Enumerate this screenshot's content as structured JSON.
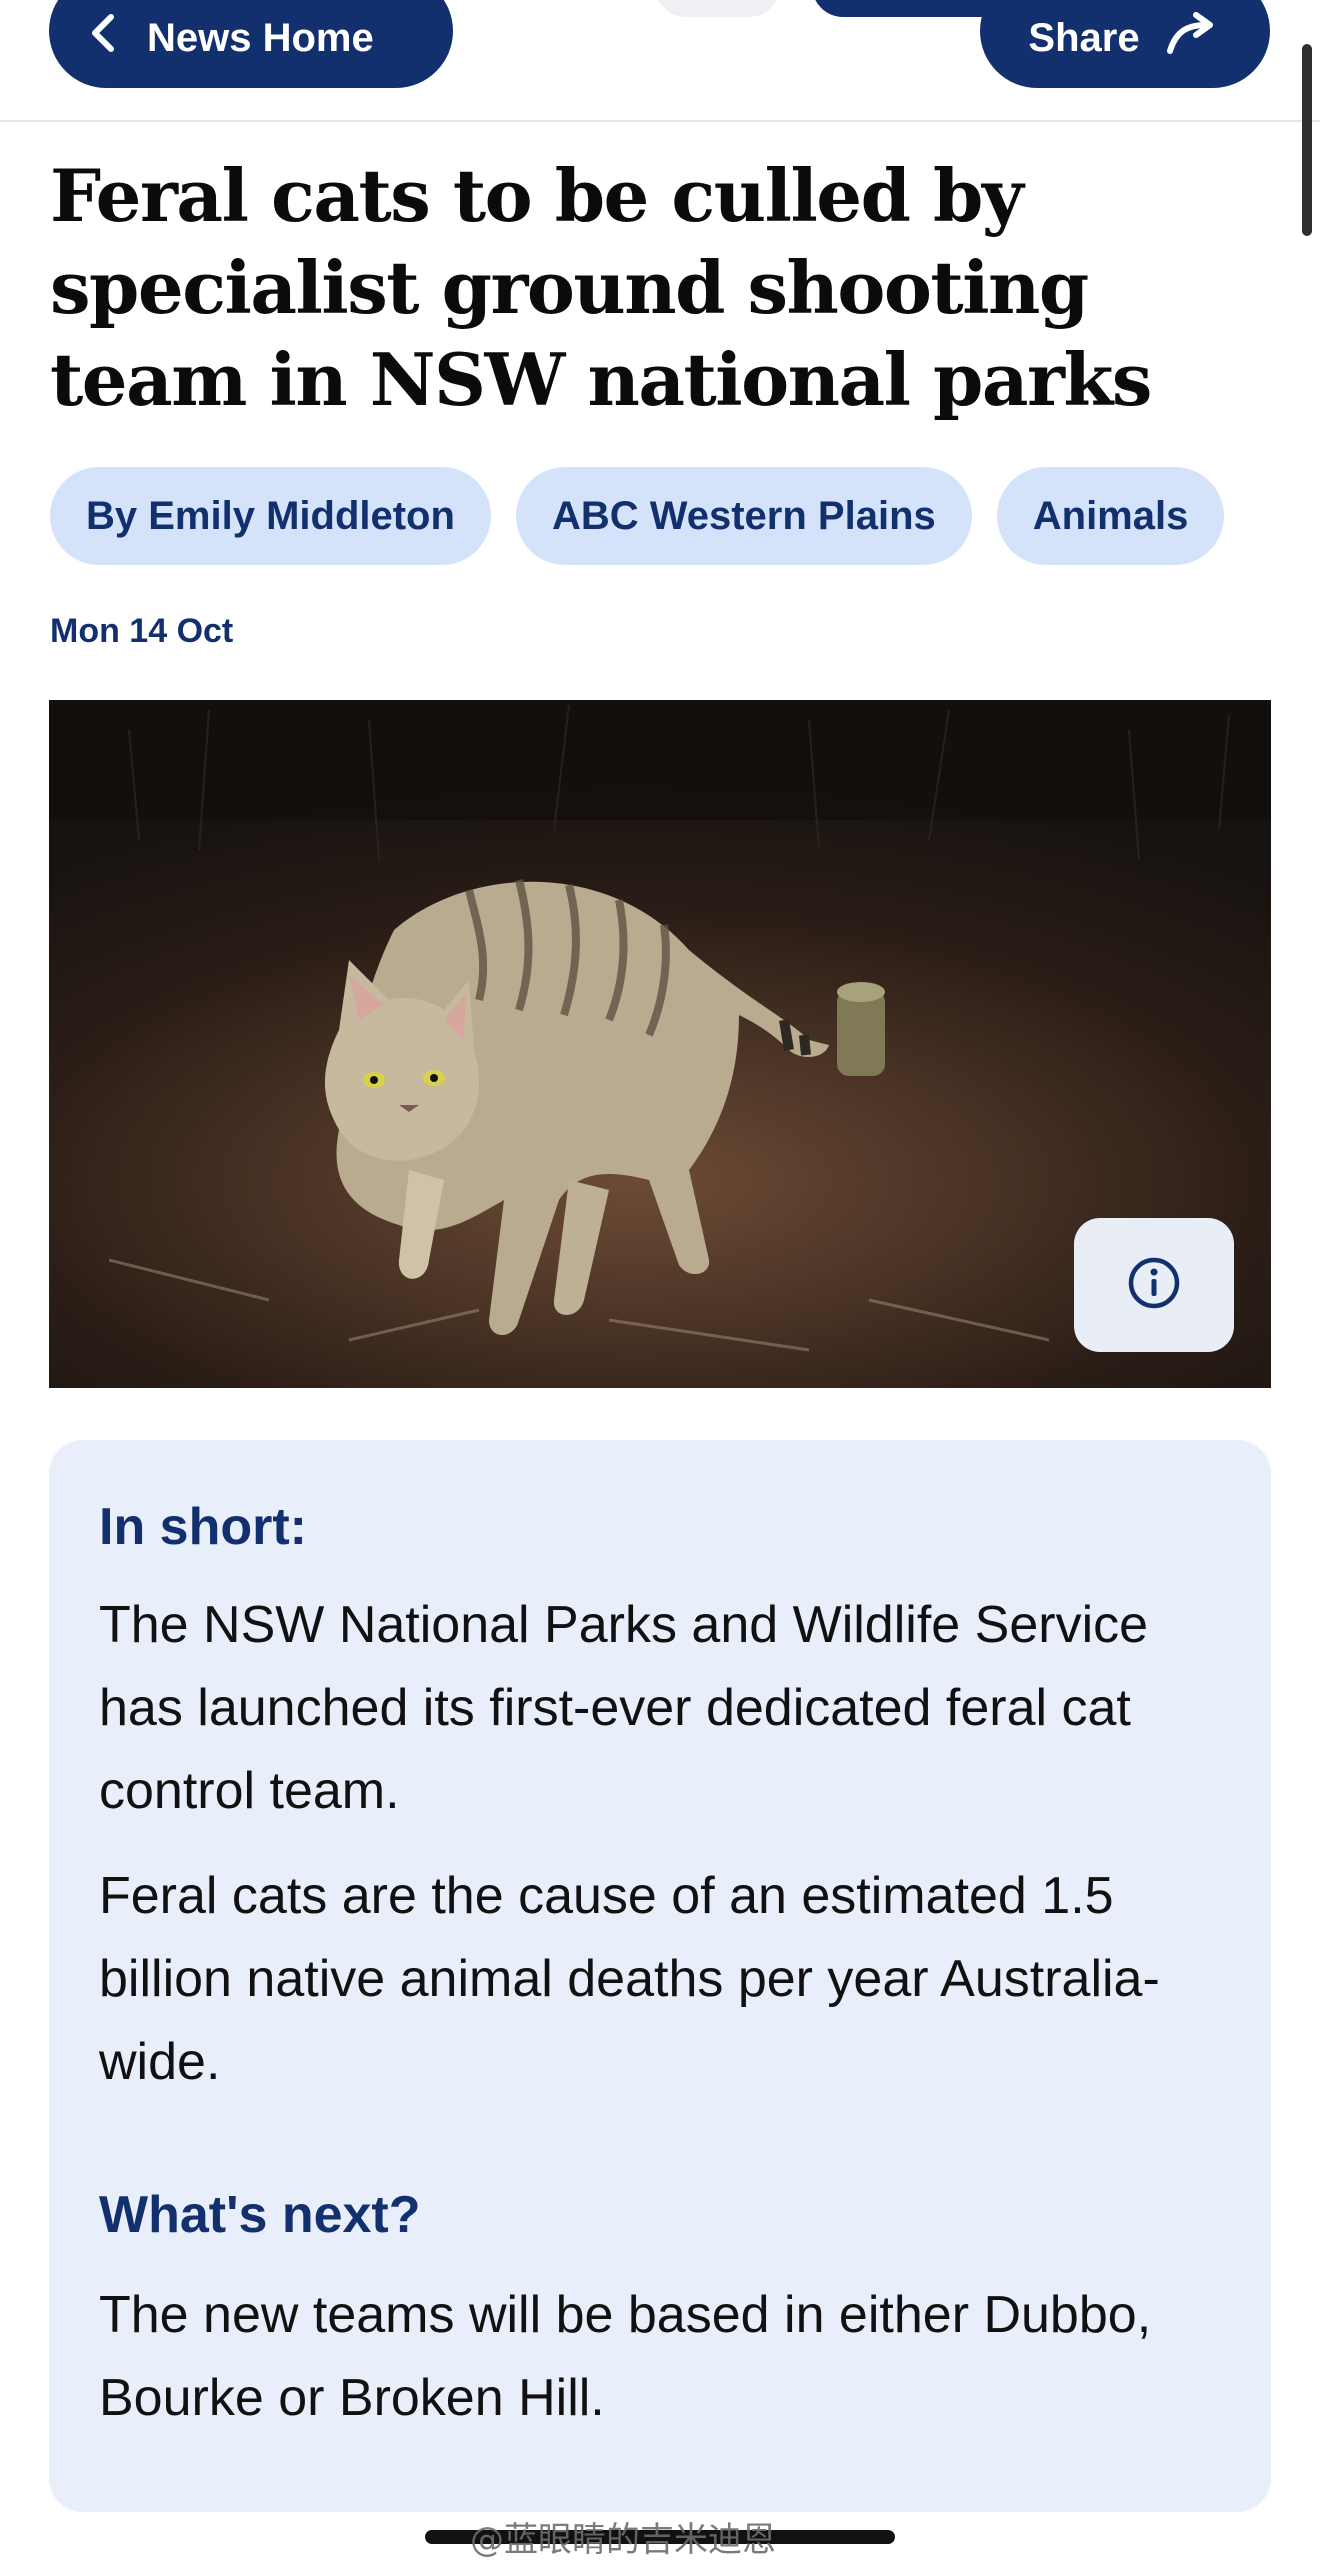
{
  "nav": {
    "back_label": "News Home",
    "share_label": "Share"
  },
  "article": {
    "headline": "Feral cats to be culled by specialist ground shooting team in NSW national parks",
    "tags": [
      "By Emily Middleton",
      "ABC Western Plains",
      "Animals"
    ],
    "date": "Mon 14 Oct"
  },
  "summary": {
    "in_short_heading": "In short:",
    "in_short_paragraphs": [
      "The NSW National Parks and Wildlife Service has launched its first-ever dedicated feral cat control team.",
      "Feral cats are the cause of an estimated 1.5 billion native animal deaths per year Australia-wide."
    ],
    "whats_next_heading": "What's next?",
    "whats_next_text": "The new teams will be based in either Dubbo, Bourke or Broken Hill."
  },
  "watermark": "@蓝眼睛的吉米迪恩",
  "icons": {
    "back": "chevron-left-icon",
    "share": "share-arrow-icon",
    "info": "info-icon"
  },
  "colors": {
    "navy": "#13306e",
    "chip": "#d5e3fa",
    "card": "#e8eefa",
    "accent_blue": "#1d5fff"
  }
}
